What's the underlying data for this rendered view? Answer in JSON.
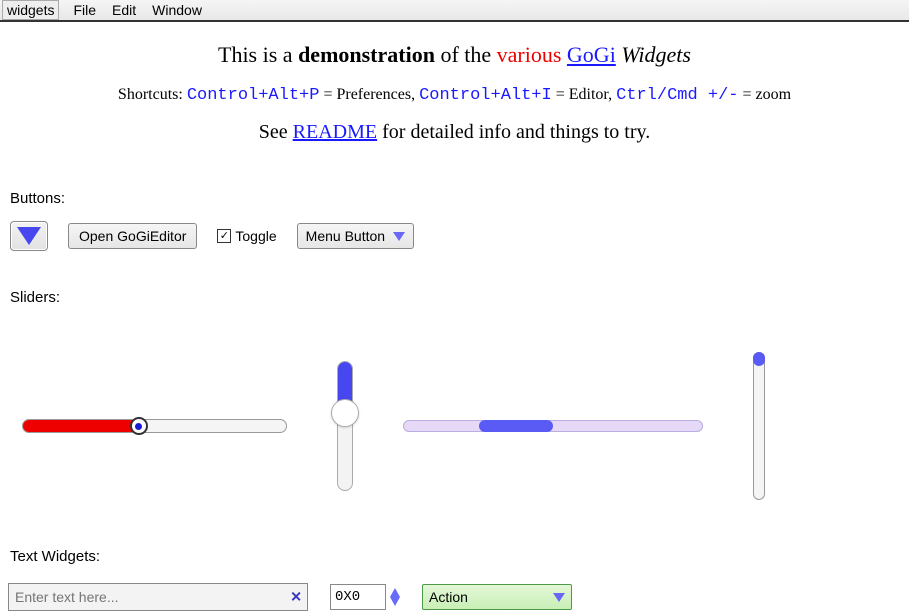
{
  "menubar": {
    "app": "widgets",
    "items": [
      "File",
      "Edit",
      "Window"
    ]
  },
  "intro": {
    "pre": "This is a ",
    "bold": "demonstration",
    "mid": " of the ",
    "red": "various",
    "link": "GoGi",
    "italic": " Widgets"
  },
  "shortcuts": {
    "prefix": "Shortcuts: ",
    "k1": "Control+Alt+P",
    "d1": " = Preferences, ",
    "k2": "Control+Alt+I",
    "d2": " = Editor, ",
    "k3": "Ctrl/Cmd +/-",
    "d3": " = zoom"
  },
  "readme": {
    "pre": "See ",
    "link": "README",
    "post": " for detailed info and things to try."
  },
  "sections": {
    "buttons": "Buttons:",
    "sliders": "Sliders:",
    "textw": "Text Widgets:"
  },
  "buttons": {
    "open_editor": "Open GoGiEditor",
    "toggle_label": "Toggle",
    "toggle_checked": "✓",
    "menu_button": "Menu Button"
  },
  "text_widgets": {
    "placeholder": "Enter text here...",
    "spin_value": "0X0",
    "combo_value": "Action"
  }
}
